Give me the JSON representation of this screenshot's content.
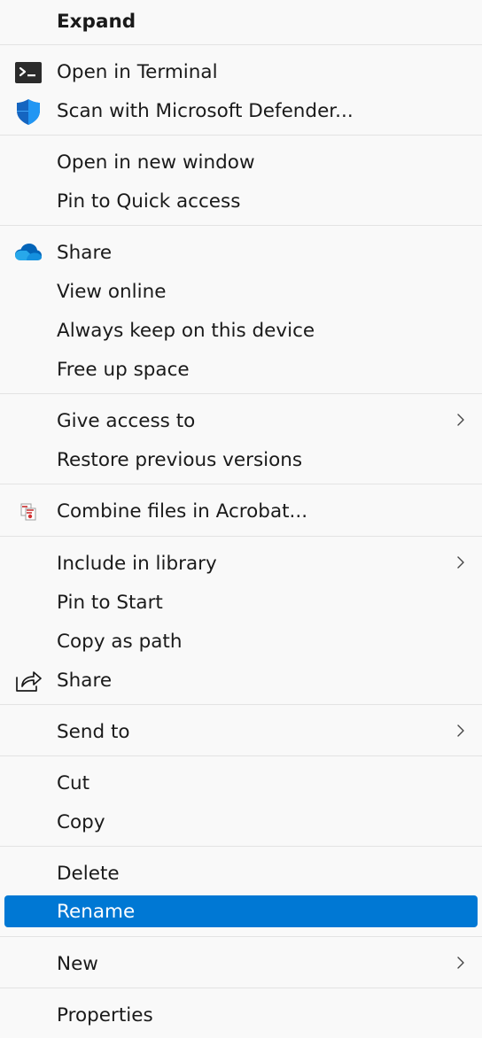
{
  "menu": {
    "expand": "Expand",
    "open_terminal": "Open in Terminal",
    "scan_defender": "Scan with Microsoft Defender...",
    "open_new_window": "Open in new window",
    "pin_quick_access": "Pin to Quick access",
    "onedrive_share": "Share",
    "view_online": "View online",
    "always_keep": "Always keep on this device",
    "free_up_space": "Free up space",
    "give_access": "Give access to",
    "restore_versions": "Restore previous versions",
    "combine_acrobat": "Combine files in Acrobat...",
    "include_library": "Include in library",
    "pin_start": "Pin to Start",
    "copy_path": "Copy as path",
    "share": "Share",
    "send_to": "Send to",
    "cut": "Cut",
    "copy": "Copy",
    "delete": "Delete",
    "rename": "Rename",
    "new": "New",
    "properties": "Properties"
  },
  "icons": {
    "terminal": "terminal-icon",
    "defender": "defender-shield-icon",
    "onedrive": "onedrive-cloud-icon",
    "acrobat": "acrobat-combine-icon",
    "share": "share-icon",
    "submenu": "chevron-right-icon"
  },
  "colors": {
    "background": "#f9f9f9",
    "separator": "#e3e3e3",
    "highlight": "#0078d4",
    "text": "#1a1a1a",
    "highlight_text": "#ffffff"
  },
  "selected_item": "Rename"
}
